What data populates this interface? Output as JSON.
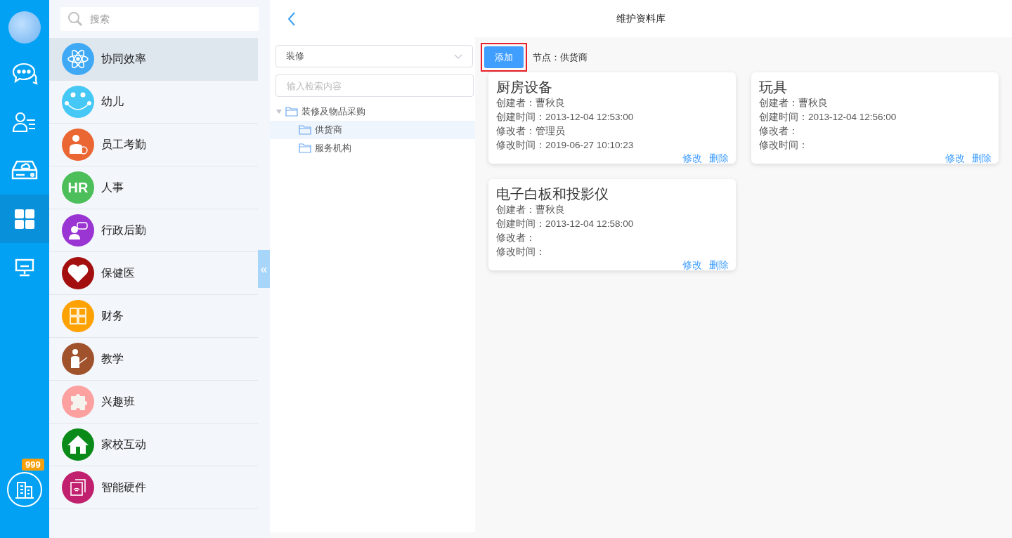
{
  "rail": {
    "items": [
      {
        "kind": "chat",
        "selected": false
      },
      {
        "kind": "contacts",
        "selected": false
      },
      {
        "kind": "drive",
        "selected": false
      },
      {
        "kind": "apps",
        "selected": true
      },
      {
        "kind": "monitor",
        "selected": false
      }
    ],
    "badge": "999"
  },
  "sidebar": {
    "search": {
      "placeholder": "搜索"
    },
    "collapse_handle": "«",
    "items": [
      {
        "label": "协同效率",
        "kind": "atom",
        "color": "#3fa9f5",
        "selected": true
      },
      {
        "label": "幼儿",
        "kind": "smiley",
        "color": "#45c8f5",
        "selected": false
      },
      {
        "label": "员工考勤",
        "kind": "person",
        "color": "#ea6632",
        "selected": false
      },
      {
        "label": "人事",
        "kind": "letters",
        "icon_text": "HR",
        "color": "#4cbf5a",
        "selected": false
      },
      {
        "label": "行政后勤",
        "kind": "speaker",
        "color": "#9a34d2",
        "selected": false
      },
      {
        "label": "保健医",
        "kind": "heart",
        "color": "#a30f0f",
        "selected": false
      },
      {
        "label": "财务",
        "kind": "calculator",
        "color": "#fea102",
        "selected": false
      },
      {
        "label": "教学",
        "kind": "teacher",
        "color": "#a0522d",
        "selected": false
      },
      {
        "label": "兴趣班",
        "kind": "puzzle",
        "color": "#fca0a0",
        "selected": false
      },
      {
        "label": "家校互动",
        "kind": "house",
        "color": "#0a8a18",
        "selected": false
      },
      {
        "label": "智能硬件",
        "kind": "tablet",
        "color": "#c0206e",
        "selected": false
      }
    ]
  },
  "header": {
    "title": "维护资料库"
  },
  "tree_panel": {
    "select": {
      "value": "装修"
    },
    "search": {
      "placeholder": "输入检索内容"
    },
    "tree": [
      {
        "label": "装修及物品采购",
        "expanded": true,
        "selected": false,
        "children": [
          {
            "label": "供货商",
            "selected": true
          },
          {
            "label": "服务机构",
            "selected": false
          }
        ]
      }
    ]
  },
  "content": {
    "add_button": {
      "label": "添加",
      "highlighted": true
    },
    "node_label": "节点：供货商",
    "cards": [
      {
        "title": "厨房设备",
        "lines": [
          "创建者：曹秋良",
          "创建时间：2013-12-04 12:53:00",
          "修改者：管理员",
          "修改时间：2019-06-27 10:10:23"
        ],
        "actions": [
          "修改",
          "删除"
        ]
      },
      {
        "title": "玩具",
        "lines": [
          "创建者：曹秋良",
          "创建时间：2013-12-04 12:56:00",
          "修改者：",
          "修改时间："
        ],
        "actions": [
          "修改",
          "删除"
        ]
      },
      {
        "title": "电子白板和投影仪",
        "lines": [
          "创建者：曹秋良",
          "创建时间：2013-12-04 12:58:00",
          "修改者：",
          "修改时间："
        ],
        "actions": [
          "修改",
          "删除"
        ]
      }
    ]
  }
}
